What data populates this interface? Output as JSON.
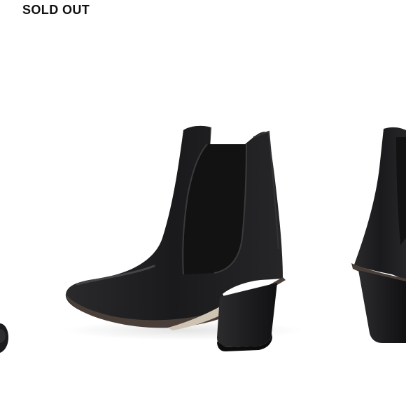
{
  "listing": {
    "status_label": "SOLD OUT"
  },
  "gallery": {
    "current_image": "black-leather-chelsea-ankle-boot-side-view",
    "previous_image": "boot-toe-partial",
    "next_image": "boot-heel-partial"
  },
  "colors": {
    "background": "#ffffff",
    "status_text": "#111111",
    "leather": "#1c1c1e",
    "elastic_panel": "#121213",
    "heel": "#222224",
    "sole_edge": "#4a3f38",
    "insole": "#cfc3b4"
  }
}
